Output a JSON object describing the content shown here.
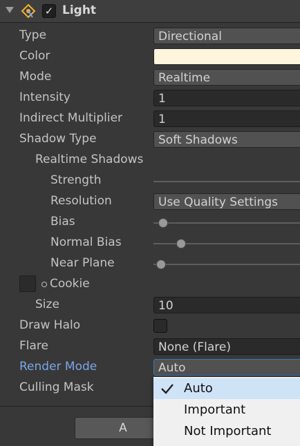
{
  "component": {
    "title": "Light",
    "enabled": true
  },
  "properties": {
    "type": {
      "label": "Type",
      "value": "Directional"
    },
    "color": {
      "label": "Color",
      "value": "#fff4dc"
    },
    "mode": {
      "label": "Mode",
      "value": "Realtime"
    },
    "intensity": {
      "label": "Intensity",
      "value": "1"
    },
    "indirect_multiplier": {
      "label": "Indirect Multiplier",
      "value": "1"
    },
    "shadow_type": {
      "label": "Shadow Type",
      "value": "Soft Shadows"
    },
    "realtime_shadows": {
      "label": "Realtime Shadows"
    },
    "strength": {
      "label": "Strength"
    },
    "resolution": {
      "label": "Resolution",
      "value": "Use Quality Settings"
    },
    "bias": {
      "label": "Bias"
    },
    "normal_bias": {
      "label": "Normal Bias"
    },
    "near_plane": {
      "label": "Near Plane"
    },
    "cookie": {
      "label": "Cookie"
    },
    "size": {
      "label": "Size",
      "value": "10"
    },
    "draw_halo": {
      "label": "Draw Halo",
      "checked": false
    },
    "flare": {
      "label": "Flare",
      "value": "None (Flare)"
    },
    "render_mode": {
      "label": "Render Mode",
      "value": "Auto"
    },
    "culling_mask": {
      "label": "Culling Mask"
    }
  },
  "render_mode_popup": {
    "options": [
      "Auto",
      "Important",
      "Not Important"
    ],
    "selected": "Auto"
  },
  "add_button": {
    "label": "A"
  },
  "icons": {
    "foldout": "foldout-arrow-icon",
    "light": "light-component-icon",
    "check": "checkmark-icon",
    "cookie": "cookie-object-picker-icon"
  },
  "colors": {
    "accent": "#3a79bb",
    "label_highlight": "#7aa6e8",
    "background": "#383838"
  }
}
